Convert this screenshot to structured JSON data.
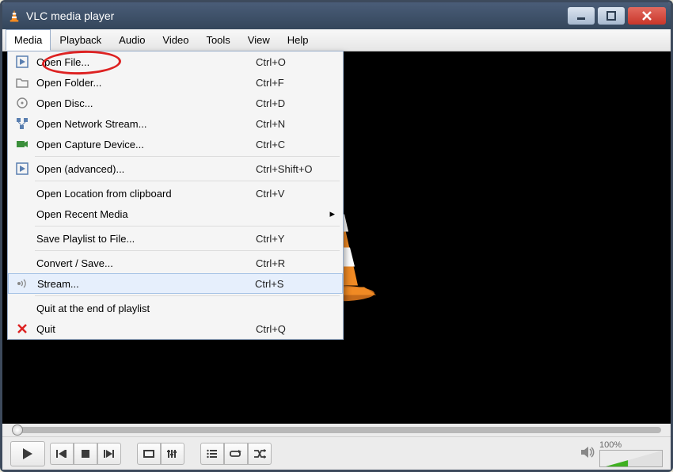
{
  "window_title": "VLC media player",
  "menubar": [
    "Media",
    "Playback",
    "Audio",
    "Video",
    "Tools",
    "View",
    "Help"
  ],
  "media_menu": {
    "items": [
      {
        "icon": "play-file-icon",
        "label": "Open File...",
        "shortcut": "Ctrl+O",
        "highlighted": true
      },
      {
        "icon": "folder-icon",
        "label": "Open Folder...",
        "shortcut": "Ctrl+F"
      },
      {
        "icon": "disc-icon",
        "label": "Open Disc...",
        "shortcut": "Ctrl+D"
      },
      {
        "icon": "network-icon",
        "label": "Open Network Stream...",
        "shortcut": "Ctrl+N"
      },
      {
        "icon": "capture-icon",
        "label": "Open Capture Device...",
        "shortcut": "Ctrl+C"
      },
      {
        "sep": true
      },
      {
        "icon": "play-file-icon",
        "label": "Open (advanced)...",
        "shortcut": "Ctrl+Shift+O"
      },
      {
        "sep": true
      },
      {
        "label": "Open Location from clipboard",
        "shortcut": "Ctrl+V"
      },
      {
        "label": "Open Recent Media",
        "submenu": true
      },
      {
        "sep": true
      },
      {
        "label": "Save Playlist to File...",
        "shortcut": "Ctrl+Y"
      },
      {
        "sep": true
      },
      {
        "label": "Convert / Save...",
        "shortcut": "Ctrl+R"
      },
      {
        "icon": "stream-icon",
        "label": "Stream...",
        "shortcut": "Ctrl+S",
        "hover": true
      },
      {
        "sep": true
      },
      {
        "label": "Quit at the end of playlist"
      },
      {
        "icon": "x-icon",
        "label": "Quit",
        "shortcut": "Ctrl+Q"
      }
    ]
  },
  "volume_label": "100%"
}
